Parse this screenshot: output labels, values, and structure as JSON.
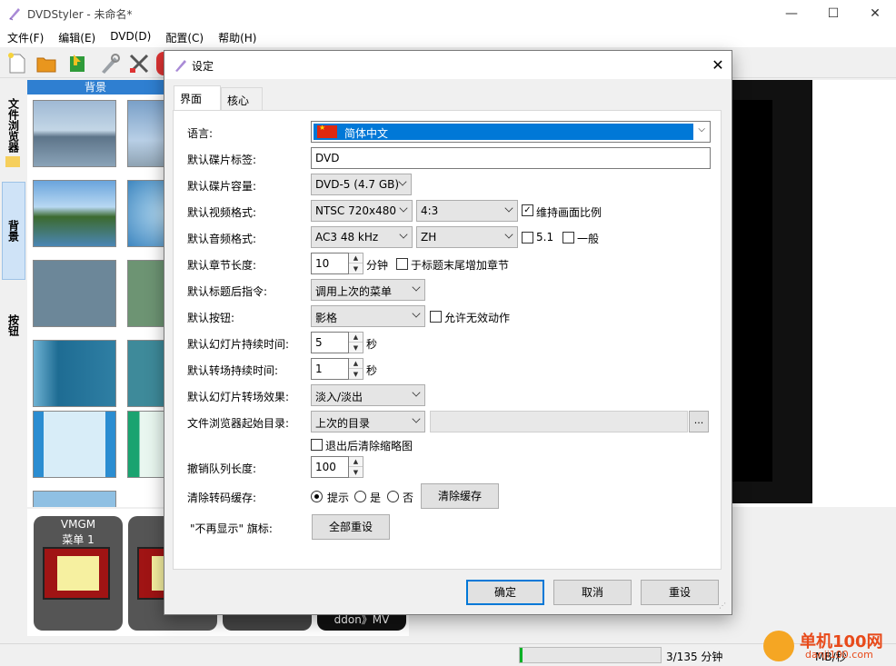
{
  "main": {
    "title": "DVDStyler - 未命名*",
    "menus": [
      "文件(F)",
      "编辑(E)",
      "DVD(D)",
      "配置(C)",
      "帮助(H)"
    ],
    "left_tabs": [
      "文件浏览器",
      "背景",
      "按钮"
    ],
    "thumb_header": "背景",
    "vmgm_label": "VMGM",
    "menu1_label": "菜单 1",
    "menu2_label": "菜",
    "ddon_label": "ddon》MV",
    "status_progress": "3/135 分钟",
    "status_rate": "MB/秒",
    "progress_fraction": 0.02
  },
  "watermark": {
    "line1": "单机100网",
    "line2": "danji100.com"
  },
  "dialog": {
    "title": "设定",
    "tabs": [
      "界面",
      "核心"
    ],
    "labels": {
      "language": "语言:",
      "disc_label": "默认碟片标签:",
      "disc_capacity": "默认碟片容量:",
      "video_format": "默认视频格式:",
      "audio_format": "默认音频格式:",
      "chapter_length": "默认章节长度:",
      "post_command": "默认标题后指令:",
      "button": "默认按钮:",
      "slide_duration": "默认幻灯片持续时间:",
      "transition_duration": "默认转场持续时间:",
      "slide_transition": "默认幻灯片转场效果:",
      "browser_start_dir": "文件浏览器起始目录:",
      "undo_length": "撤销队列长度:",
      "clear_cache": "清除转码缓存:",
      "dont_show": "\"不再显示\" 旗标:"
    },
    "values": {
      "language": "简体中文",
      "disc_label": "DVD",
      "disc_capacity": "DVD-5 (4.7 GB)",
      "video_format": "NTSC 720x480",
      "aspect": "4:3",
      "keep_aspect": "维持画面比例",
      "audio_format": "AC3 48 kHz",
      "audio_lang": "ZH",
      "surround": "5.1",
      "normal": "一般",
      "chapter_length": "10",
      "chapter_unit": "分钟",
      "add_chapter_end": "于标题末尾增加章节",
      "post_command": "调用上次的菜单",
      "button": "影格",
      "allow_invalid": "允许无效动作",
      "slide_duration": "5",
      "slide_unit": "秒",
      "transition_duration": "1",
      "transition_unit": "秒",
      "slide_transition": "淡入/淡出",
      "browser_start_dir": "上次的目录",
      "browse_dots": "...",
      "clear_thumbs": "退出后清除缩略图",
      "undo_length": "100",
      "radio_prompt": "提示",
      "radio_yes": "是",
      "radio_no": "否",
      "clear_cache_btn": "清除缓存",
      "reset_all_btn": "全部重设"
    },
    "buttons": {
      "ok": "确定",
      "cancel": "取消",
      "reset": "重设"
    }
  }
}
